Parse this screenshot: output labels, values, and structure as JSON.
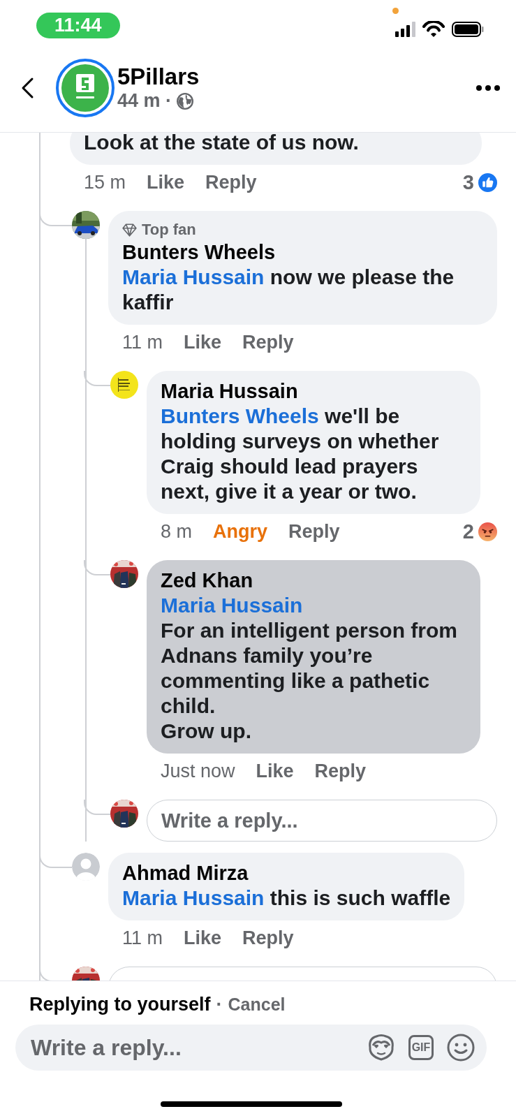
{
  "status_bar": {
    "time": "11:44"
  },
  "header": {
    "title": "5Pillars",
    "meta": "44 m ·"
  },
  "comments": [
    {
      "kind": "comment",
      "text": "Look at the state of us now.",
      "highlighted": false,
      "time": "15 m",
      "reaction": {
        "label": "Like",
        "selected": false
      },
      "reply_label": "Reply",
      "reaction_summary": {
        "count": "3",
        "kind": "like"
      },
      "children": [
        {
          "kind": "comment",
          "badge": "Top fan",
          "author": "Bunters Wheels",
          "mention": "Maria Hussain",
          "text": " now we please the kaffir",
          "highlighted": false,
          "time": "11 m",
          "reaction": {
            "label": "Like",
            "selected": false
          },
          "reply_label": "Reply",
          "children": [
            {
              "kind": "comment",
              "author": "Maria Hussain",
              "mention": "Bunters Wheels",
              "text": " we'll be holding surveys on whether Craig should lead prayers next, give it a year or two.",
              "highlighted": false,
              "time": "8 m",
              "reaction": {
                "label": "Angry",
                "kind": "angry",
                "selected": true
              },
              "reply_label": "Reply",
              "reaction_summary": {
                "count": "2",
                "kind": "angry"
              }
            },
            {
              "kind": "comment",
              "author": "Zed Khan",
              "mention": "Maria Hussain",
              "text": "\nFor an intelligent person from Adnans family you’re commenting like a pathetic child.\nGrow up.",
              "highlighted": true,
              "time": "Just now",
              "reaction": {
                "label": "Like",
                "selected": false
              },
              "reply_label": "Reply"
            },
            {
              "kind": "reply_box",
              "placeholder": "Write a reply..."
            }
          ]
        },
        {
          "kind": "comment",
          "avatar": {
            "kind": "silhouette"
          },
          "author": "Ahmad Mirza",
          "mention": "Maria Hussain",
          "text": " this is such waffle",
          "highlighted": false,
          "time": "11 m",
          "reaction": {
            "label": "Like",
            "selected": false
          },
          "reply_label": "Reply"
        },
        {
          "kind": "reply_box"
        }
      ]
    }
  ],
  "composer": {
    "context": "Replying to yourself",
    "separator": "·",
    "cancel": "Cancel",
    "placeholder": "Write a reply...",
    "gif_label": "GIF"
  }
}
